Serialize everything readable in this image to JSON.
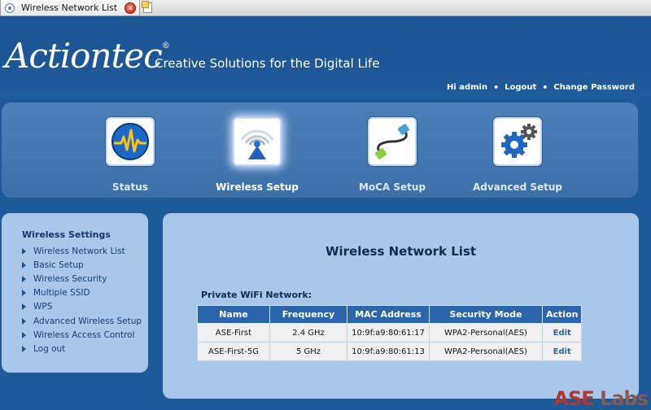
{
  "browser": {
    "tab_title": "Wireless Network List",
    "close_glyph": "✕"
  },
  "header": {
    "logo_main": "Actiontec",
    "logo_mark": "®",
    "tagline": "Creative Solutions for the Digital Life",
    "greeting": "Hi admin",
    "logout_label": "Logout",
    "change_password_label": "Change Password",
    "separator": "•"
  },
  "nav": {
    "items": [
      {
        "label": "Status",
        "icon": "status-icon",
        "active": false
      },
      {
        "label": "Wireless Setup",
        "icon": "wireless-icon",
        "active": true
      },
      {
        "label": "MoCA Setup",
        "icon": "moca-icon",
        "active": false
      },
      {
        "label": "Advanced Setup",
        "icon": "gear-icon",
        "active": false
      }
    ]
  },
  "sidebar": {
    "title": "Wireless Settings",
    "items": [
      {
        "label": "Wireless Network List"
      },
      {
        "label": "Basic Setup"
      },
      {
        "label": "Wireless Security"
      },
      {
        "label": "Multiple SSID"
      },
      {
        "label": "WPS"
      },
      {
        "label": "Advanced Wireless Setup"
      },
      {
        "label": "Wireless Access Control"
      },
      {
        "label": "Log out"
      }
    ]
  },
  "main": {
    "title": "Wireless Network List",
    "section_label": "Private WiFi Network:",
    "columns": [
      "Name",
      "Frequency",
      "MAC Address",
      "Security Mode",
      "Action"
    ],
    "rows": [
      {
        "name": "ASE-First",
        "frequency": "2.4 GHz",
        "mac": "10:9f:a9:80:61:17",
        "security": "WPA2-Personal(AES)",
        "action": "Edit"
      },
      {
        "name": "ASE-First-5G",
        "frequency": "5 GHz",
        "mac": "10:9f:a9:80:61:13",
        "security": "WPA2-Personal(AES)",
        "action": "Edit"
      }
    ]
  },
  "watermark": {
    "brand": "ASE",
    "suffix": "Labs"
  },
  "colors": {
    "header_bg": "#1b5393",
    "panel_bg": "#a9c7ea",
    "table_header": "#2b66ad",
    "edit_link": "#2f63a7"
  }
}
